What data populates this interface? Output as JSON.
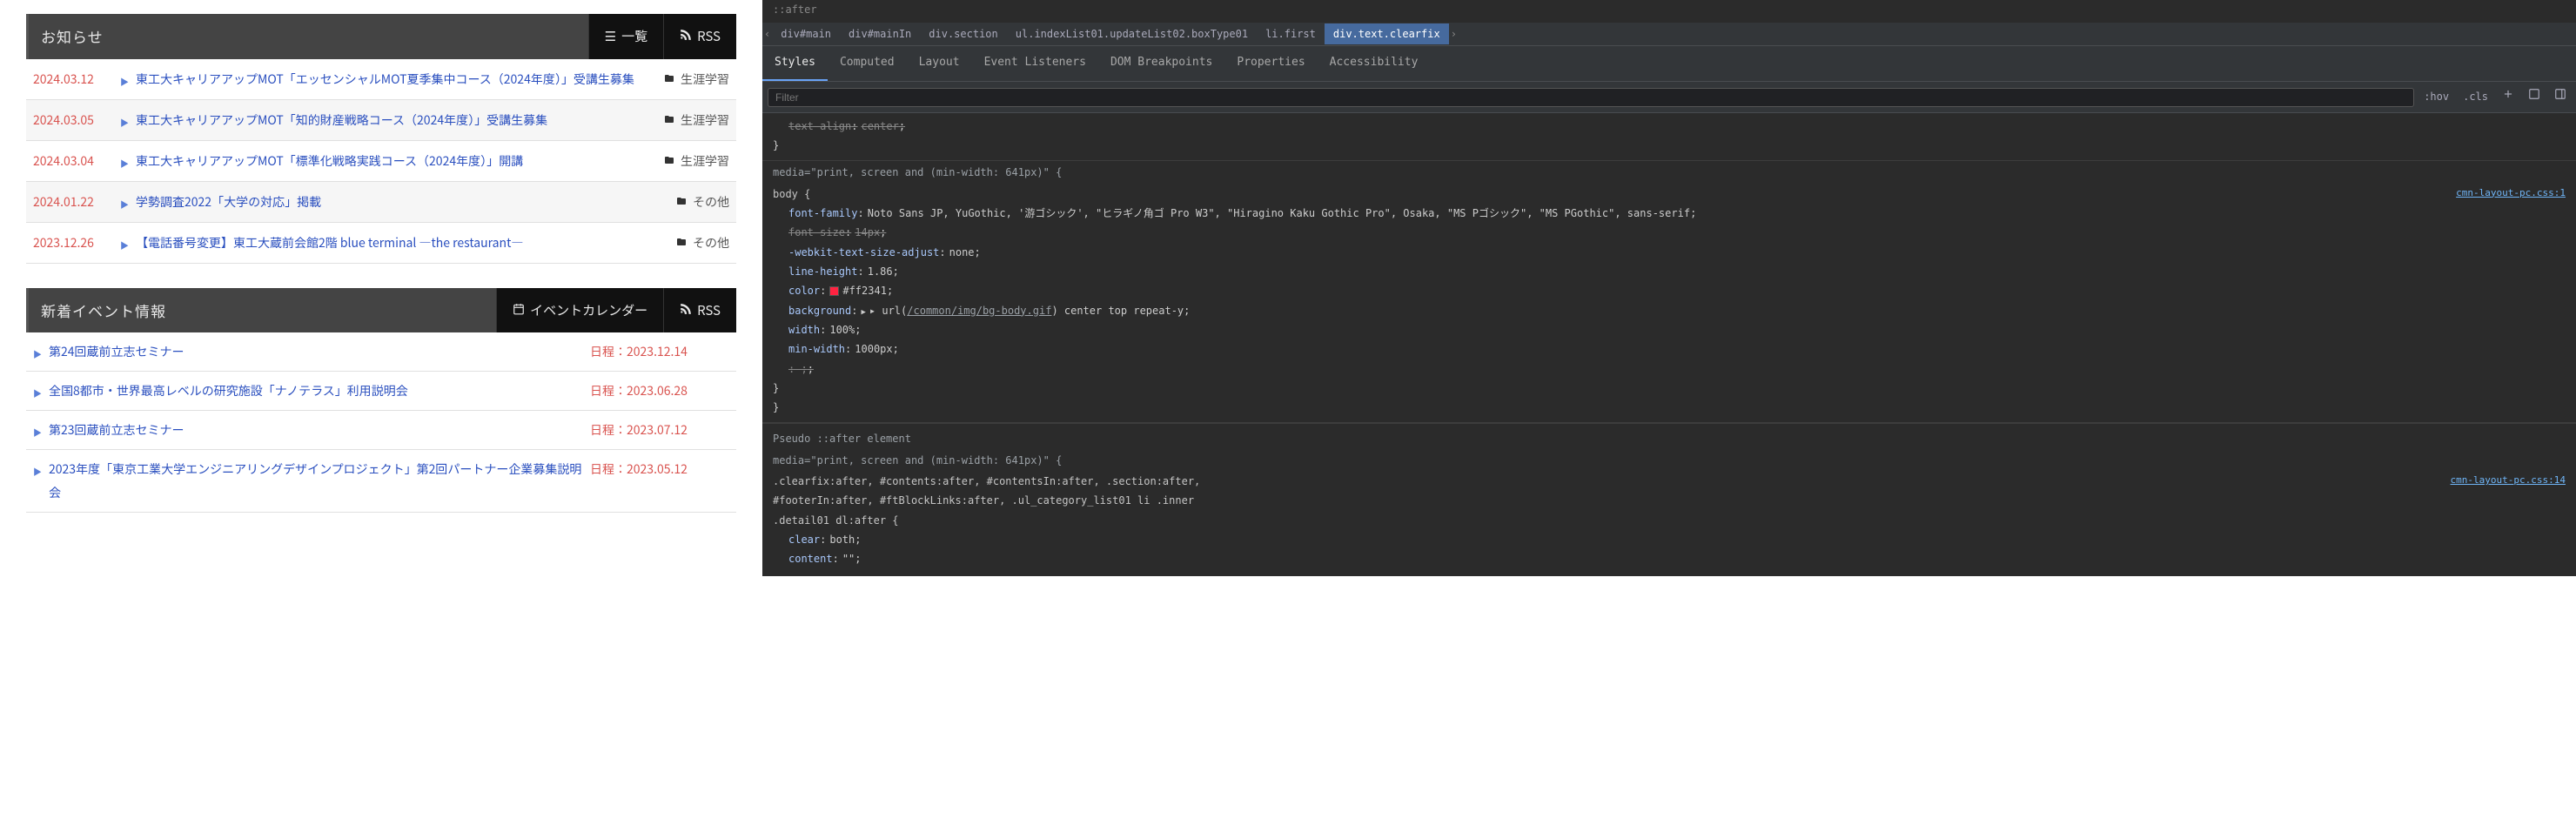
{
  "news_section": {
    "title": "お知らせ",
    "list_btn": "一覧",
    "rss_btn": "RSS",
    "items": [
      {
        "date": "2024.03.12",
        "title": "東工大キャリアアップMOT「エッセンシャルMOT夏季集中コース（2024年度）」受講生募集",
        "category": "生涯学習"
      },
      {
        "date": "2024.03.05",
        "title": "東工大キャリアアップMOT「知的財産戦略コース（2024年度）」受講生募集",
        "category": "生涯学習"
      },
      {
        "date": "2024.03.04",
        "title": "東工大キャリアアップMOT「標準化戦略実践コース（2024年度）」開講",
        "category": "生涯学習"
      },
      {
        "date": "2024.01.22",
        "title": "学勢調査2022「大学の対応」掲載",
        "category": "その他"
      },
      {
        "date": "2023.12.26",
        "title": "【電話番号変更】東工大蔵前会館2階 blue terminal ―the restaurant―",
        "category": "その他"
      }
    ]
  },
  "event_section": {
    "title": "新着イベント情報",
    "calendar_btn": "イベントカレンダー",
    "rss_btn": "RSS",
    "date_prefix": "日程：",
    "items": [
      {
        "title": "第24回蔵前立志セミナー",
        "date": "2023.12.14"
      },
      {
        "title": "全国8都市・世界最高レベルの研究施設「ナノテラス」利用説明会",
        "date": "2023.06.28"
      },
      {
        "title": "第23回蔵前立志セミナー",
        "date": "2023.07.12"
      },
      {
        "title": "2023年度「東京工業大学エンジニアリングデザインプロジェクト」第2回パートナー企業募集説明会",
        "date": "2023.05.12"
      }
    ]
  },
  "devtools": {
    "pseudo_top": "::after",
    "breadcrumb": [
      "div#main",
      "div#mainIn",
      "div.section",
      "ul.indexList01.updateList02.boxType01",
      "li.first",
      "div.text.clearfix"
    ],
    "breadcrumb_selected_index": 5,
    "tabs": [
      "Styles",
      "Computed",
      "Layout",
      "Event Listeners",
      "DOM Breakpoints",
      "Properties",
      "Accessibility"
    ],
    "active_tab_index": 0,
    "filter_placeholder": "Filter",
    "hov": ":hov",
    "cls": ".cls",
    "rules": {
      "block0": {
        "prop_text_align": "text-align",
        "val_text_align": "center"
      },
      "media1": "media=\"print, screen and (min-width: 641px)\" {",
      "block1": {
        "selector": "body {",
        "source": "cmn-layout-pc.css:1",
        "font_family_name": "font-family",
        "font_family_val": "Noto Sans JP, YuGothic, '游ゴシック', \"ヒラギノ角ゴ Pro W3\", \"Hiragino Kaku Gothic Pro\", Osaka, \"MS Pゴシック\", \"MS PGothic\", sans-serif",
        "font_size_name": "font-size",
        "font_size_val": "14px",
        "webkit_name": "-webkit-text-size-adjust",
        "webkit_val": "none",
        "lh_name": "line-height",
        "lh_val": "1.86",
        "color_name": "color",
        "color_val": "#ff2341",
        "bg_name": "background",
        "bg_val_pre": "▸ url(",
        "bg_url": "/common/img/bg-body.gif",
        "bg_val_post": ") center top repeat-y",
        "width_name": "width",
        "width_val": "100%",
        "minw_name": "min-width",
        "minw_val": "1000px",
        "extra": ": ;"
      },
      "pseudo_label": "Pseudo ::after element",
      "media2": "media=\"print, screen and (min-width: 641px)\" {",
      "block2": {
        "selector": ".clearfix:after, #contents:after, #contentsIn:after, .section:after, #footerIn:after, #ftBlockLinks:after, .ul_category_list01 li .inner .detail01 dl:after {",
        "source": "cmn-layout-pc.css:14",
        "clear_name": "clear",
        "clear_val": "both",
        "content_name": "content",
        "content_val": "\"\""
      }
    }
  }
}
